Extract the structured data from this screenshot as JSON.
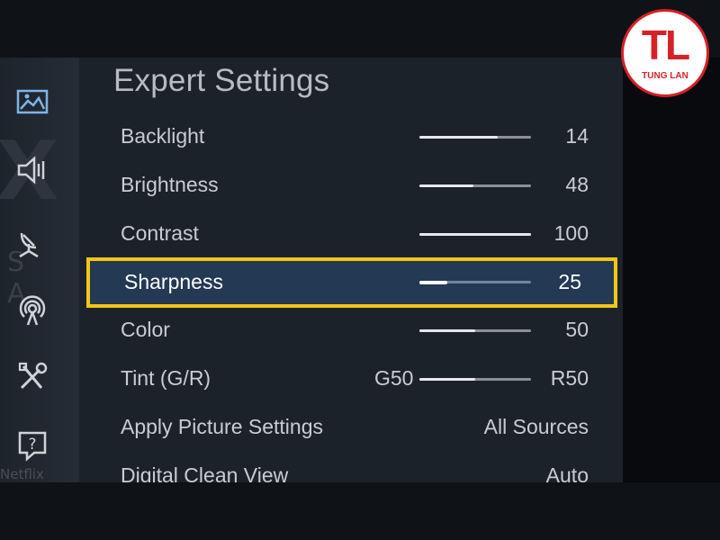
{
  "panel": {
    "title": "Expert Settings"
  },
  "sidebar": {
    "watermark_top": "X",
    "watermark_middle": "S A",
    "watermark_bottom": "Netflix",
    "icons": [
      "picture-icon",
      "sound-icon",
      "broadcast-icon",
      "network-icon",
      "tools-icon",
      "support-icon"
    ]
  },
  "settings": [
    {
      "label": "Backlight",
      "value": "14",
      "level": 0.7
    },
    {
      "label": "Brightness",
      "value": "48",
      "level": 0.48
    },
    {
      "label": "Contrast",
      "value": "100",
      "level": 1.0
    },
    {
      "label": "Sharpness",
      "value": "25",
      "level": 0.25,
      "selected": true
    },
    {
      "label": "Color",
      "value": "50",
      "level": 0.5
    },
    {
      "label": "Tint (G/R)",
      "left_value": "G50",
      "value": "R50",
      "level": 0.5
    },
    {
      "label": "Apply Picture Settings",
      "value": "All Sources"
    },
    {
      "label": "Digital Clean View",
      "value": "Auto"
    }
  ],
  "logo": {
    "letters": "TL",
    "text": "TUNG LAN"
  },
  "colors": {
    "highlight_border": "#f2c617",
    "selected_bg": "#233954",
    "logo_red": "#d62128"
  }
}
